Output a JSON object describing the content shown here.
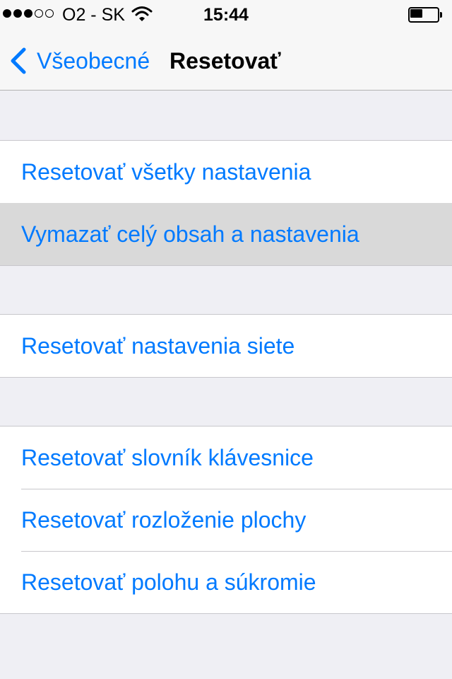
{
  "status_bar": {
    "signal_bars_filled": 3,
    "signal_bars_total": 5,
    "carrier": "O2 - SK",
    "time": "15:44",
    "battery_level": 0.45
  },
  "nav": {
    "back_label": "Všeobecné",
    "title": "Resetovať"
  },
  "groups": [
    {
      "items": [
        {
          "label": "Resetovať všetky nastavenia"
        },
        {
          "label": "Vymazať celý obsah a nastavenia",
          "highlighted": true
        }
      ]
    },
    {
      "items": [
        {
          "label": "Resetovať nastavenia siete"
        }
      ]
    },
    {
      "items": [
        {
          "label": "Resetovať slovník klávesnice"
        },
        {
          "label": "Resetovať rozloženie plochy"
        },
        {
          "label": "Resetovať polohu a súkromie"
        }
      ]
    }
  ],
  "colors": {
    "accent": "#007aff",
    "background": "#efeff4",
    "highlight": "#d9d9d9"
  }
}
